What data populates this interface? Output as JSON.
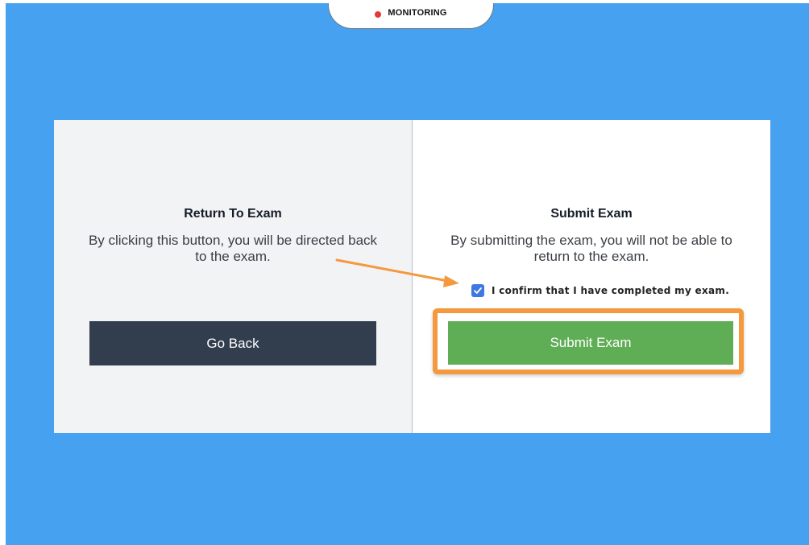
{
  "monitoring": {
    "label": "MONITORING",
    "dot_color": "#e53935"
  },
  "return_section": {
    "title": "Return To Exam",
    "description": "By clicking this button, you will be directed back to the exam.",
    "button_label": "Go Back"
  },
  "submit_section": {
    "title": "Submit Exam",
    "description": "By submitting the exam, you will not be able to return to the exam.",
    "confirm_label": "I confirm that I have completed my exam.",
    "confirm_checked": true,
    "button_label": "Submit Exam"
  },
  "annotations": {
    "highlight_color": "#f4993e",
    "arrow_color": "#f4993e"
  },
  "colors": {
    "background": "#47a1f1",
    "go_back_button": "#323e4e",
    "submit_button": "#5fae56",
    "checkbox": "#3f78e0"
  }
}
